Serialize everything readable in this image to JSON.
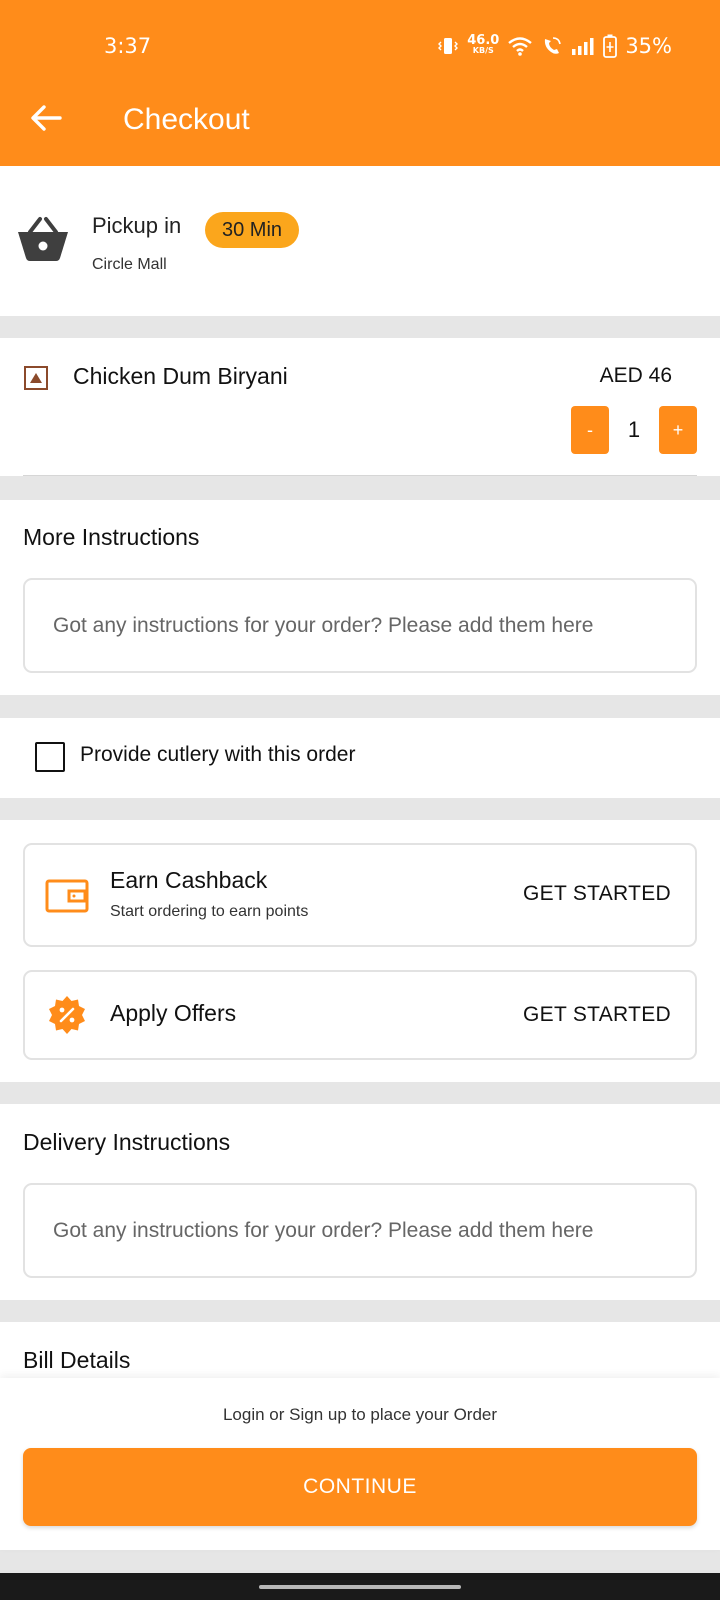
{
  "status_bar": {
    "time": "3:37",
    "net_speed_value": "46.0",
    "net_speed_unit": "KB/S",
    "battery": "35%"
  },
  "header": {
    "title": "Checkout",
    "back_icon": "arrow-left-icon",
    "background_color": "#ff8c1a"
  },
  "pickup": {
    "label": "Pickup in",
    "eta": "30 Min",
    "location": "Circle Mall",
    "icon": "basket-icon"
  },
  "cart": {
    "items": [
      {
        "name": "Chicken Dum Biryani",
        "price": "AED 46",
        "quantity": "1",
        "decrement_label": "-",
        "increment_label": "+"
      }
    ]
  },
  "more_instructions": {
    "title": "More Instructions",
    "placeholder": "Got any instructions for your order? Please add them here"
  },
  "cutlery": {
    "label": "Provide cutlery with this order",
    "checked": false
  },
  "offers": {
    "cashback": {
      "title": "Earn Cashback",
      "subtitle": "Start ordering to earn points",
      "action": "GET STARTED",
      "icon": "wallet-icon"
    },
    "apply_offers": {
      "title": "Apply Offers",
      "action": "GET STARTED",
      "icon": "discount-badge-icon"
    }
  },
  "delivery_instructions": {
    "title": "Delivery Instructions",
    "placeholder": "Got any instructions for your order? Please add them here"
  },
  "bill": {
    "title": "Bill Details"
  },
  "footer": {
    "message": "Login or Sign up to place your Order",
    "continue_label": "CONTINUE"
  }
}
